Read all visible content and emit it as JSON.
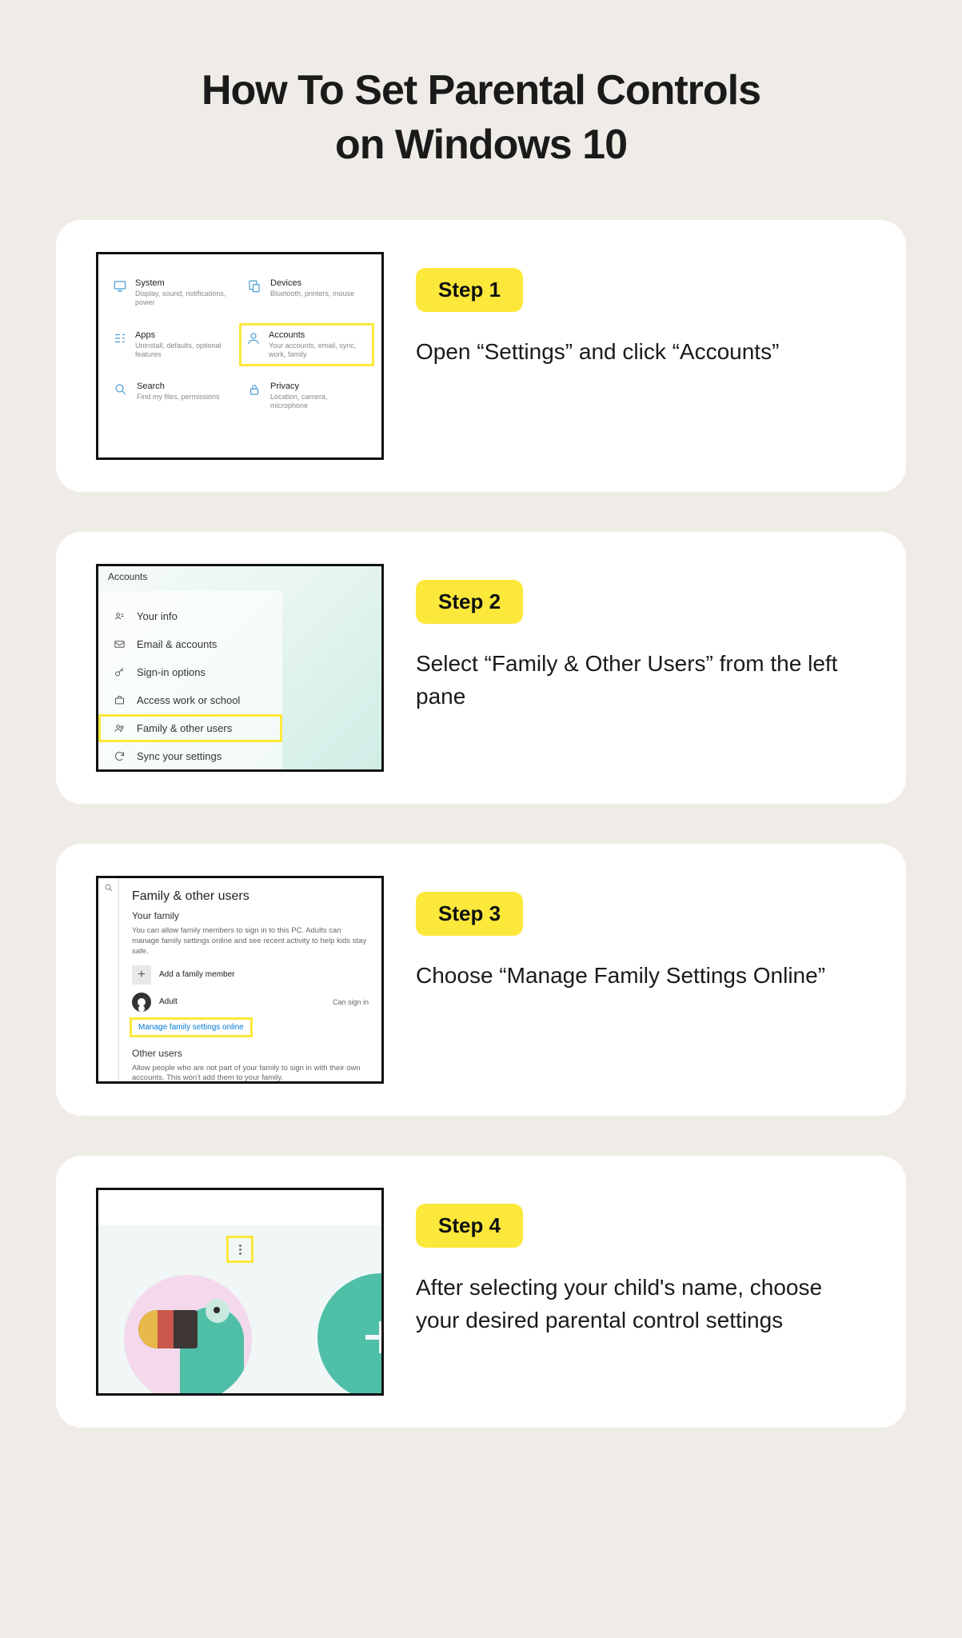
{
  "title_line1": "How To Set Parental Controls",
  "title_line2": "on Windows 10",
  "steps": [
    {
      "label": "Step 1",
      "desc": "Open “Settings” and click “Accounts”",
      "grid": [
        {
          "name": "System",
          "sub": "Display, sound, notifications, power"
        },
        {
          "name": "Devices",
          "sub": "Bluetooth, printers, mouse"
        },
        {
          "name": "Apps",
          "sub": "Uninstall, defaults, optional features"
        },
        {
          "name": "Accounts",
          "sub": "Your accounts, email, sync, work, family"
        },
        {
          "name": "Search",
          "sub": "Find my files, permissions"
        },
        {
          "name": "Privacy",
          "sub": "Location, camera, microphone"
        }
      ]
    },
    {
      "label": "Step 2",
      "desc": "Select “Family & Other Users” from the left pane",
      "header": "Accounts",
      "items": [
        "Your info",
        "Email & accounts",
        "Sign-in options",
        "Access work or school",
        "Family & other users",
        "Sync your settings"
      ]
    },
    {
      "label": "Step 3",
      "desc": "Choose “Manage Family Settings Online”",
      "heading": "Family & other users",
      "sub1": "Your family",
      "para1": "You can allow family members to sign in to this PC. Adults can manage family settings online and see recent activity to help kids stay safe.",
      "add": "Add a family member",
      "adult": "Adult",
      "cansignin": "Can sign in",
      "link": "Manage family settings online",
      "sub2": "Other users",
      "para2": "Allow people who are not part of your family to sign in with their own accounts. This won't add them to your family."
    },
    {
      "label": "Step 4",
      "desc": "After selecting your child's name, choose your desired parental control settings"
    }
  ]
}
